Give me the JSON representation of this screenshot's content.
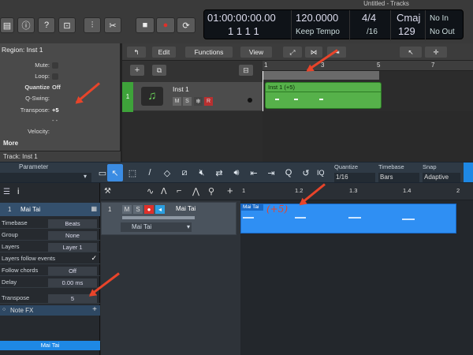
{
  "logic": {
    "window_title": "Untitled - Tracks",
    "lcd": {
      "time": "01:00:00:00.00",
      "bars": "1  1  1  1",
      "tempo": "120.0000",
      "tempo_mode": "Keep Tempo",
      "signature_top": "4/4",
      "signature_bottom": "/16",
      "key": "Cmaj",
      "key_number": "129",
      "no_in": "No In",
      "no_out": "No Out"
    },
    "region_inspector": {
      "header": "Region: Inst 1",
      "rows": [
        {
          "label": "Mute:",
          "value": ""
        },
        {
          "label": "Loop:",
          "value": ""
        },
        {
          "label": "Quantize",
          "value": "Off"
        },
        {
          "label": "Q-Swing:",
          "value": ""
        },
        {
          "label": "Transpose:",
          "value": "+5"
        },
        {
          "label": "",
          "value": "- -"
        },
        {
          "label": "Velocity:",
          "value": ""
        }
      ],
      "more": "More",
      "track_header": "Track:  Inst 1"
    },
    "menus": [
      "Edit",
      "Functions",
      "View"
    ],
    "ruler_marks": [
      "1",
      "3",
      "5",
      "7"
    ],
    "track": {
      "number": "1",
      "name": "Inst 1",
      "m": "M",
      "s": "S",
      "r": "R"
    },
    "region_name": "Inst 1 (+5)"
  },
  "studio_one": {
    "parameter_label": "Parameter",
    "quantize": {
      "label": "Quantize",
      "value": "1/16"
    },
    "timebase": {
      "label": "Timebase",
      "value": "Bars"
    },
    "snap": {
      "label": "Snap",
      "value": "Adaptive"
    },
    "iq": "IQ",
    "inspector_track": {
      "number": "1",
      "name": "Mai Tai"
    },
    "properties": [
      {
        "label": "Timebase",
        "value": "Beats"
      },
      {
        "label": "Group",
        "value": "None"
      },
      {
        "label": "Layers",
        "value": "Layer 1"
      },
      {
        "label": "Layers follow events",
        "value": "✓"
      },
      {
        "label": "Follow chords",
        "value": "Off"
      },
      {
        "label": "Delay",
        "value": "0.00 ms"
      },
      {
        "label": "Transpose",
        "value": "5"
      }
    ],
    "note_fx": "Note FX",
    "channel_footer": "Mai Tai",
    "track": {
      "number": "1",
      "name": "Mai Tai",
      "m": "M",
      "s": "S",
      "instrument": "Mai Tai"
    },
    "ruler_marks": [
      "1",
      "1.2",
      "1.3",
      "1.4",
      "2"
    ],
    "event_name": "Mai Tai",
    "annotation": "(+5)"
  },
  "colors": {
    "logic_region": "#56b14a",
    "s1_event": "#2f8ff3",
    "arrow": "#e8442a",
    "record": "#e0302a"
  }
}
